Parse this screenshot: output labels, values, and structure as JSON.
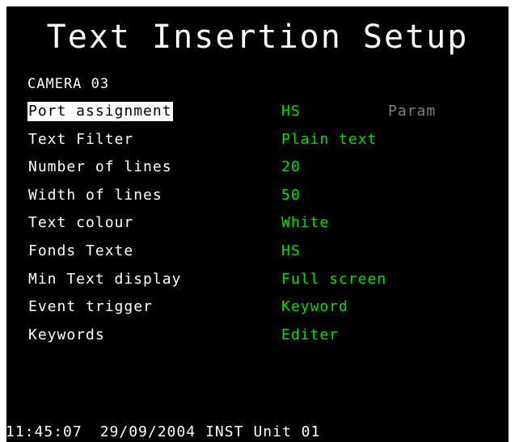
{
  "title": "Text Insertion Setup",
  "camera": "CAMERA 03",
  "menu": [
    {
      "label": "Port assignment",
      "value": "HS",
      "extra": "Param",
      "selected": true
    },
    {
      "label": "Text Filter",
      "value": "Plain text"
    },
    {
      "label": "Number of lines",
      "value": "20"
    },
    {
      "label": "Width of lines",
      "value": "50"
    },
    {
      "label": "Text colour",
      "value": "White"
    },
    {
      "label": "Fonds Texte",
      "value": "HS"
    },
    {
      "label": "Min Text display",
      "value": "Full screen"
    },
    {
      "label": "Event trigger",
      "value": "Keyword"
    },
    {
      "label": "Keywords",
      "value": "Editer"
    }
  ],
  "status": {
    "time": "11:45:07",
    "date": "29/09/2004",
    "mode": "INST",
    "unit": "Unit 01"
  },
  "colors": {
    "background": "#000000",
    "label": "#ffffff",
    "value": "#00e000",
    "disabled": "#808080",
    "selection": "#ffffff"
  }
}
